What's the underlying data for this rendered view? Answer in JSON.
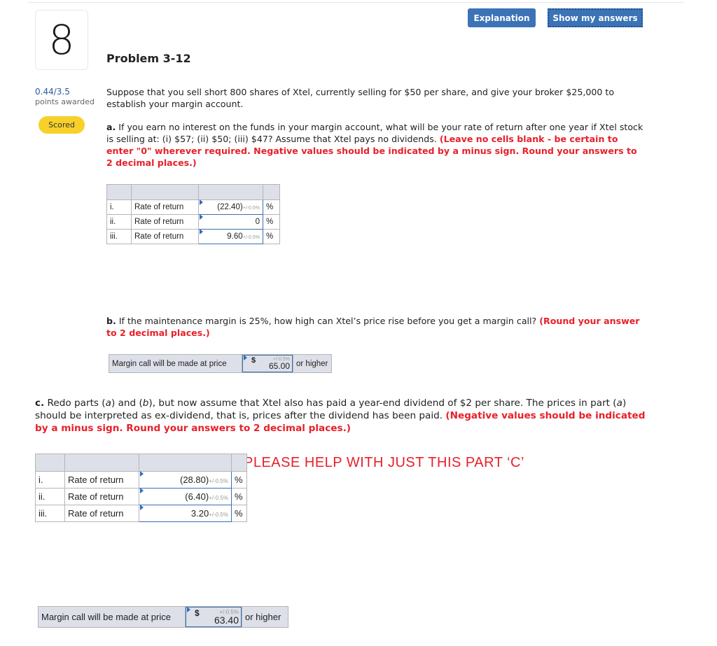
{
  "question": {
    "number": "8",
    "title": "Problem 3-12",
    "points_value": "0.44/3.5",
    "points_label": "points awarded",
    "status_badge": "Scored"
  },
  "toolbar": {
    "explanation_label": "Explanation",
    "show_answers_label": "Show my answers"
  },
  "intro": "Suppose that you sell short 800 shares of Xtel, currently selling for $50 per share, and give your broker $25,000 to establish your margin account.",
  "part_a": {
    "lead": "a.",
    "text": " If you earn no interest on the funds in your margin account, what will be your rate of return after one year if Xtel stock is selling at: (i) $57; (ii) $50; (iii) $47? Assume that Xtel pays no dividends. ",
    "instructions": "(Leave no cells blank - be certain to enter \"0\" wherever required. Negative values should be indicated by a minus sign. Round your answers to 2 decimal places.)",
    "rows": [
      {
        "index": "i.",
        "label": "Rate of return",
        "value": "(22.40)",
        "tolerance": "+/-0.5%",
        "unit": "%"
      },
      {
        "index": "ii.",
        "label": "Rate of return",
        "value": "0",
        "tolerance": "",
        "unit": "%"
      },
      {
        "index": "iii.",
        "label": "Rate of return",
        "value": "9.60",
        "tolerance": "+/-0.5%",
        "unit": "%"
      }
    ]
  },
  "part_b": {
    "lead": "b.",
    "text": " If the maintenance margin is 25%, how high can Xtel’s price rise before you get a margin call? ",
    "instructions": "(Round your answer to 2 decimal places.)",
    "margin_label": "Margin call will be made at price",
    "currency": "$",
    "tolerance": "+/-0.5%",
    "value": "65.00",
    "suffix": "or higher"
  },
  "part_c": {
    "lead": "c.",
    "text_1": " Redo parts (",
    "italic_a": "a",
    "text_2": ") and (",
    "italic_b": "b",
    "text_3": "), but now assume that Xtel also has paid a year-end dividend of $2 per share. The prices in part (",
    "italic_a2": "a",
    "text_4": ") should be interpreted as ex-dividend, that is, prices after the dividend has been paid. ",
    "instructions": "(Negative values should be indicated by a minus sign. Round your answers to 2 decimal places.)",
    "rows": [
      {
        "index": "i.",
        "label": "Rate of return",
        "value": "(28.80)",
        "tolerance": "+/-0.5%",
        "unit": "%"
      },
      {
        "index": "ii.",
        "label": "Rate of return",
        "value": "(6.40)",
        "tolerance": "+/-0.5%",
        "unit": "%"
      },
      {
        "index": "iii.",
        "label": "Rate of return",
        "value": "3.20",
        "tolerance": "+/-0.5%",
        "unit": "%"
      }
    ],
    "margin_label": "Margin call will be made at price",
    "currency": "$",
    "tolerance": "+/-0.5%",
    "value": "63.40",
    "suffix": "or higher"
  },
  "help_note": "PLEASE HELP WITH JUST THIS PART ‘C’",
  "colors": {
    "button_blue": "#3b73b6",
    "badge_yellow": "#f7d02a",
    "instruction_red": "#e8202a",
    "points_blue": "#2d5aa0"
  }
}
